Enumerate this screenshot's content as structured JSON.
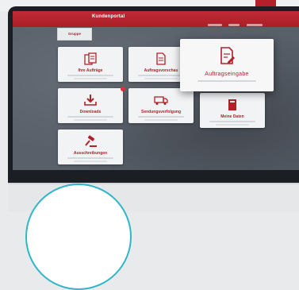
{
  "app": {
    "title": "Kundenportal",
    "logo_text": "Gruppe"
  },
  "tiles": [
    {
      "label": "Ihre Aufträge",
      "icon": "documents-icon"
    },
    {
      "label": "Auftragsvorschau",
      "icon": "document-icon"
    },
    {
      "label": "Auftragseingabe",
      "icon": "document-edit-icon"
    },
    {
      "label": "Downloads",
      "icon": "download-icon"
    },
    {
      "label": "Sendungsverfolgung",
      "icon": "truck-icon"
    },
    {
      "label": "Meine Daten",
      "icon": "book-icon"
    },
    {
      "label": "Ausschreibungen",
      "icon": "gavel-icon"
    }
  ],
  "colors": {
    "accent": "#b3202a",
    "screen_bg": "#59606a",
    "circle": "#2fb6c8"
  }
}
